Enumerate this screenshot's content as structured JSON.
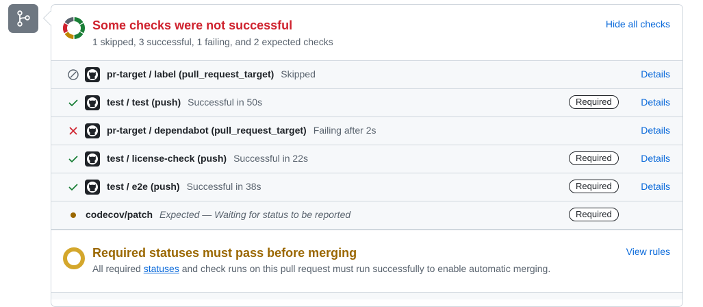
{
  "summary": {
    "title": "Some checks were not successful",
    "subtitle": "1 skipped, 3 successful, 1 failing, and 2 expected checks",
    "hide_label": "Hide all checks"
  },
  "checks": [
    {
      "name": "pr-target / label (pull_request_target)",
      "description": "Skipped",
      "status": "skipped",
      "status_icon": "skip-icon",
      "app_icon": "github-icon",
      "required": "",
      "details": "Details"
    },
    {
      "name": "test / test (push)",
      "description": "Successful in 50s",
      "status": "success",
      "status_icon": "check-icon",
      "app_icon": "github-icon",
      "required": "Required",
      "details": "Details"
    },
    {
      "name": "pr-target / dependabot (pull_request_target)",
      "description": "Failing after 2s",
      "status": "failure",
      "status_icon": "x-icon",
      "app_icon": "github-icon",
      "required": "",
      "details": "Details"
    },
    {
      "name": "test / license-check (push)",
      "description": "Successful in 22s",
      "status": "success",
      "status_icon": "check-icon",
      "app_icon": "github-icon",
      "required": "Required",
      "details": "Details"
    },
    {
      "name": "test / e2e (push)",
      "description": "Successful in 38s",
      "status": "success",
      "status_icon": "check-icon",
      "app_icon": "github-icon",
      "required": "Required",
      "details": "Details"
    },
    {
      "name": "codecov/patch",
      "description": "Expected — Waiting for status to be reported",
      "status": "expected",
      "status_icon": "dot-icon",
      "app_icon": "",
      "required": "Required",
      "details": ""
    }
  ],
  "merge": {
    "title": "Required statuses must pass before merging",
    "body_prefix": "All required ",
    "body_link": "statuses",
    "body_suffix": " and check runs on this pull request must run successfully to enable automatic merging.",
    "rules_label": "View rules"
  },
  "colors": {
    "failure": "#cf222e",
    "success": "#1a7f37",
    "pending": "#bf8700",
    "expected": "#9a6700",
    "skipped": "#59636e",
    "link": "#0969da"
  }
}
